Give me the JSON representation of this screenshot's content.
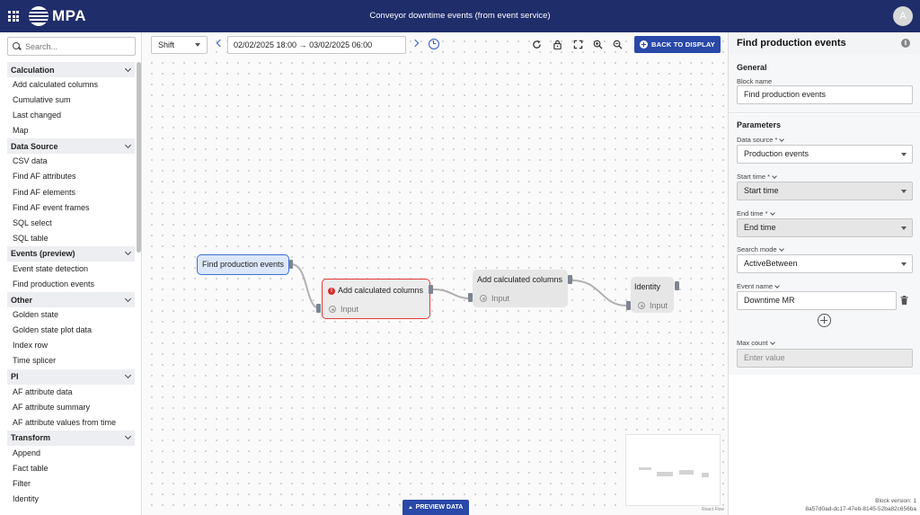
{
  "header": {
    "app_name": "MPA",
    "title": "Conveyor downtime events (from event service)",
    "avatar_initial": "A"
  },
  "sidebar": {
    "search_placeholder": "Search...",
    "categories": [
      {
        "name": "Calculation",
        "items": [
          "Add calculated columns",
          "Cumulative sum",
          "Last changed",
          "Map"
        ]
      },
      {
        "name": "Data Source",
        "items": [
          "CSV data",
          "Find AF attributes",
          "Find AF elements",
          "Find AF event frames",
          "SQL select",
          "SQL table"
        ]
      },
      {
        "name": "Events (preview)",
        "items": [
          "Event state detection",
          "Find production events"
        ]
      },
      {
        "name": "Other",
        "items": [
          "Golden state",
          "Golden state plot data",
          "Index row",
          "Time splicer"
        ]
      },
      {
        "name": "PI",
        "items": [
          "AF attribute data",
          "AF attribute summary",
          "AF attribute values from time"
        ]
      },
      {
        "name": "Transform",
        "items": [
          "Append",
          "Fact table",
          "Filter",
          "Identity"
        ]
      }
    ]
  },
  "toolbar": {
    "shift_value": "Shift",
    "time_range": "02/02/2025 18:00 → 03/02/2025 06:00",
    "back_button": "BACK TO DISPLAY"
  },
  "canvas": {
    "nodes": [
      {
        "title": "Find production events",
        "port": ""
      },
      {
        "title": "Add calculated columns",
        "port": "Input",
        "error": true
      },
      {
        "title": "Add calculated columns",
        "port": "Input"
      },
      {
        "title": "Identity",
        "port": "Input"
      }
    ],
    "preview_button": "PREVIEW DATA",
    "attribution": "React Flow"
  },
  "panel": {
    "title": "Find production events",
    "general_heading": "General",
    "block_name_label": "Block name",
    "block_name_value": "Find production events",
    "parameters_heading": "Parameters",
    "data_source_label": "Data source *",
    "data_source_value": "Production events",
    "start_time_label": "Start time *",
    "start_time_value": "Start time",
    "end_time_label": "End time *",
    "end_time_value": "End time",
    "search_mode_label": "Search mode",
    "search_mode_value": "ActiveBetween",
    "event_name_label": "Event name",
    "event_name_value": "Downtime MR",
    "max_count_label": "Max count",
    "max_count_placeholder": "Enter value",
    "block_version": "Block version: 1",
    "block_id": "8a57d0ad-dc17-47eb-8145-52ba82c656ba"
  },
  "icons": {
    "app_menu": "grid-icon",
    "search": "search-icon",
    "clock": "clock-icon",
    "refresh": "refresh-icon",
    "lock": "lock-icon",
    "fit": "fit-view-icon",
    "zoom_in": "zoom-in-icon",
    "zoom_out": "zoom-out-icon",
    "info": "info-icon",
    "trash": "trash-icon",
    "add": "add-circle-icon",
    "error": "error-icon"
  },
  "colors": {
    "header_bg": "#1f2d6b",
    "primary_button": "#2948a8",
    "link_blue": "#2a5cc5",
    "error_red": "#d32f2f",
    "selected_node_border": "#3b6fd8",
    "selected_node_bg": "#dde7fb"
  }
}
